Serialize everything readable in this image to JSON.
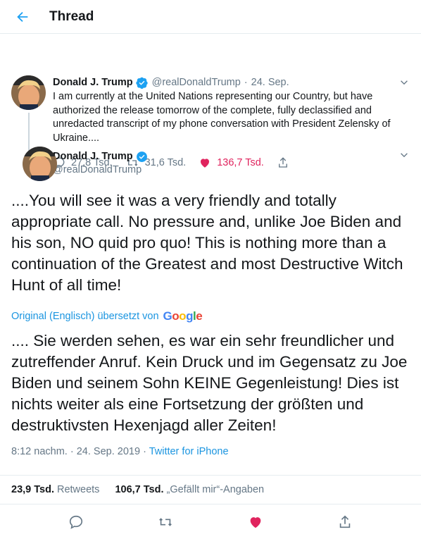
{
  "header": {
    "title": "Thread"
  },
  "tweet1": {
    "name": "Donald J. Trump",
    "handle": "@realDonaldTrump",
    "separator": "·",
    "date": "24. Sep.",
    "text": "I am currently at the United Nations representing our Country, but have authorized the release tomorrow of the complete, fully declassified and unredacted transcript of my phone conversation with President Zelensky of Ukraine....",
    "replies": "27,8 Tsd.",
    "retweets": "31,6 Tsd.",
    "likes": "136,7 Tsd."
  },
  "main_tweet": {
    "name": "Donald J. Trump",
    "handle": "@realDonaldTrump",
    "text": "....You will see it was a very friendly and totally appropriate call. No pressure and, unlike Joe Biden and his son, NO quid pro quo! This is nothing more than a continuation of the Greatest and most Destructive Witch Hunt of all time!",
    "translate_label": "Original (Englisch) übersetzt von",
    "translate_brand": [
      "G",
      "o",
      "o",
      "g",
      "l",
      "e"
    ],
    "translated_text": ".... Sie werden sehen, es war ein sehr freundlicher und zutreffender Anruf. Kein Druck und im Gegensatz zu Joe Biden und seinem Sohn KEINE Gegenleistung! Dies ist nichts weiter als eine Fortsetzung der größten und destruktivsten Hexenjagd aller Zeiten!",
    "time": "8:12 nachm.",
    "date": "24. Sep. 2019",
    "separator": "·",
    "source": "Twitter for iPhone"
  },
  "stats": {
    "retweets_count": "23,9 Tsd.",
    "retweets_label": "Retweets",
    "likes_count": "106,7 Tsd.",
    "likes_label": "„Gefällt mir“-Angaben"
  },
  "colors": {
    "accent": "#1da1f2",
    "like": "#e0245e",
    "secondary_text": "#657786"
  },
  "icons": {
    "back": "arrow-left-icon",
    "verified": "verified-badge-icon",
    "caret": "chevron-down-icon",
    "reply": "reply-icon",
    "retweet": "retweet-icon",
    "like": "heart-icon",
    "share": "share-icon"
  }
}
